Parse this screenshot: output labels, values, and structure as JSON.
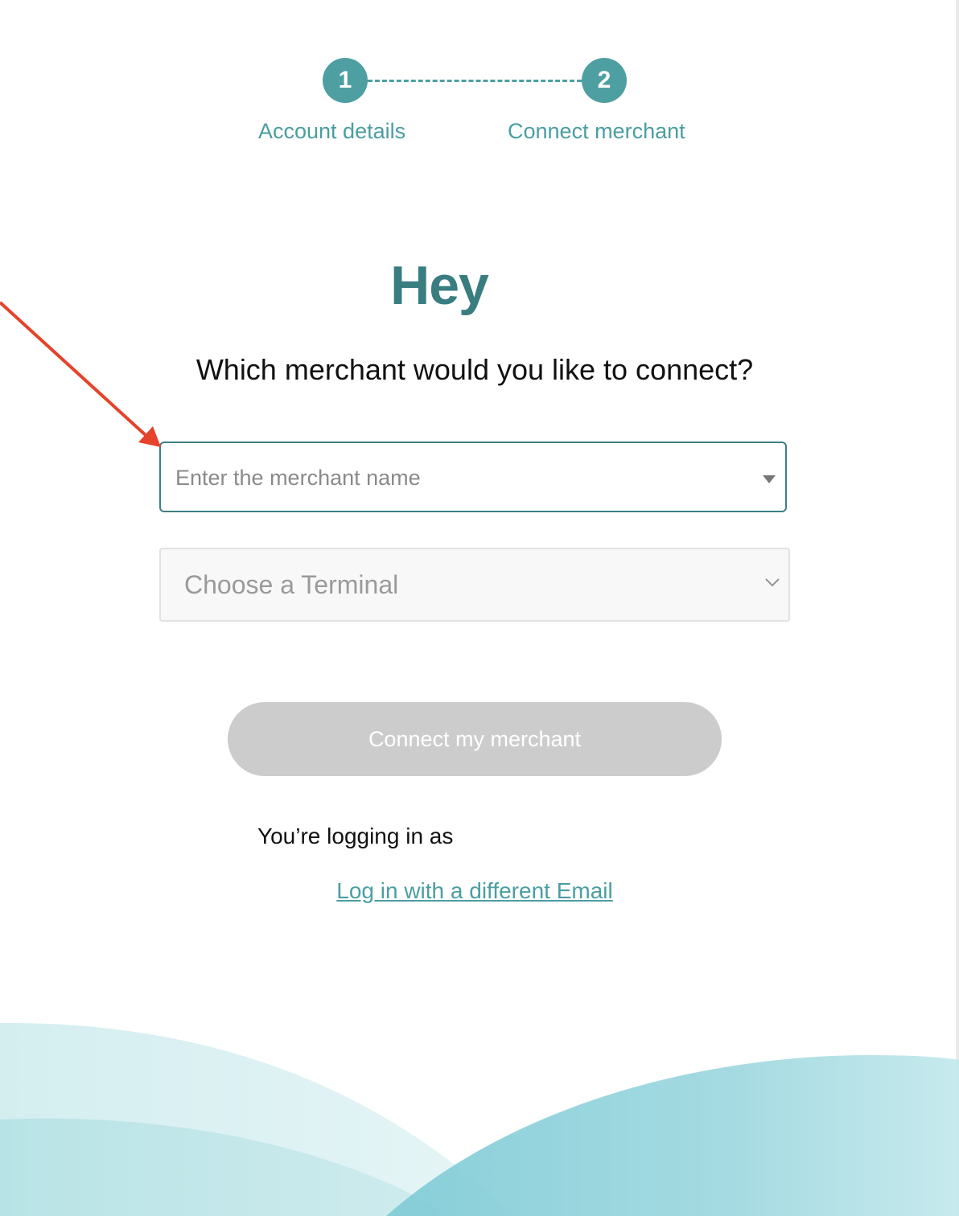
{
  "stepper": {
    "steps": [
      {
        "number": "1",
        "label": "Account details"
      },
      {
        "number": "2",
        "label": "Connect merchant"
      }
    ]
  },
  "main": {
    "title": "Hey",
    "question": "Which merchant would you like to connect?",
    "merchant_input": {
      "placeholder": "Enter the merchant name",
      "value": ""
    },
    "terminal_select": {
      "selected": "Choose a Terminal"
    },
    "connect_button": "Connect my merchant",
    "logging_in_as": "You’re logging in as",
    "different_email_link": "Log in with a different Email"
  },
  "annotation": {
    "color": "#e5432b"
  },
  "colors": {
    "accent": "#4e9fa2",
    "title": "#3a7d81",
    "disabled_button": "#cccccc"
  }
}
